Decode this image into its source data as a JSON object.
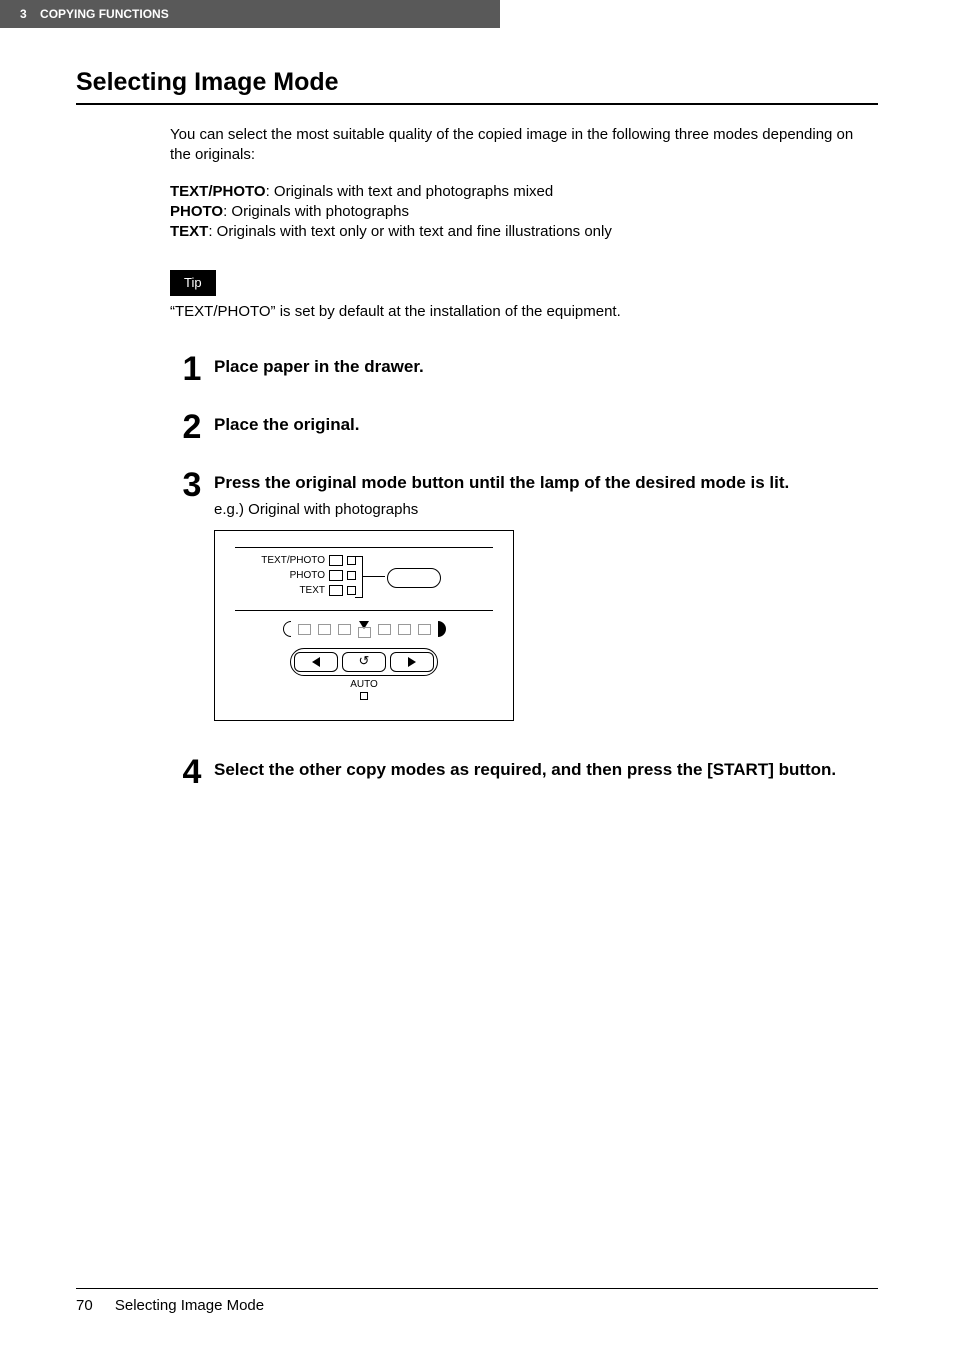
{
  "header": {
    "chapter_num": "3",
    "chapter_title": "COPYING FUNCTIONS"
  },
  "section_title": "Selecting Image Mode",
  "intro": "You can select the most suitable quality of the copied image in the following three modes depending on the originals:",
  "modes": [
    {
      "name": "TEXT/PHOTO",
      "desc": ": Originals with text and photographs mixed"
    },
    {
      "name": "PHOTO",
      "desc": ": Originals with photographs"
    },
    {
      "name": "TEXT",
      "desc": ": Originals with text only or with text and fine illustrations only"
    }
  ],
  "tip_label": "Tip",
  "tip_text": "“TEXT/PHOTO” is set by default at the installation of the equipment.",
  "steps": [
    {
      "num": "1",
      "title": "Place paper in the drawer."
    },
    {
      "num": "2",
      "title": "Place the original."
    },
    {
      "num": "3",
      "title": "Press the original mode button until the lamp of the desired mode is lit.",
      "sub": "e.g.) Original with photographs"
    },
    {
      "num": "4",
      "title": "Select the other copy modes as required, and then press the [START] button."
    }
  ],
  "panel": {
    "mode_labels": [
      "TEXT/PHOTO",
      "PHOTO",
      "TEXT"
    ],
    "auto_label": "AUTO",
    "reset_symbol": "↺"
  },
  "footer": {
    "page": "70",
    "title": "Selecting Image Mode"
  }
}
